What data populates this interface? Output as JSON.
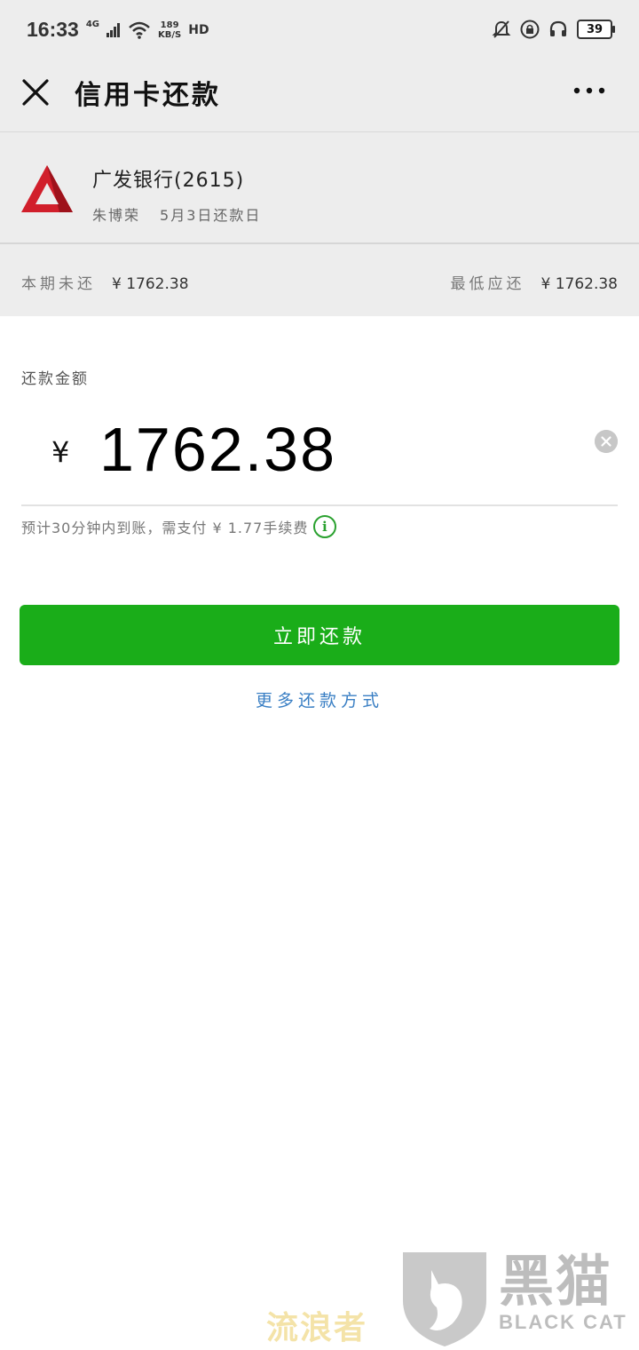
{
  "status_bar": {
    "time": "16:33",
    "network": "4G",
    "speed_value": "189",
    "speed_unit": "KB/S",
    "hd": "HD",
    "battery": "39"
  },
  "nav": {
    "title": "信用卡还款"
  },
  "card": {
    "bank_name": "广发银行(2615)",
    "holder": "朱博荣",
    "due": "5月3日还款日"
  },
  "summary": {
    "unpaid_label": "本期未还",
    "unpaid_value": "¥ 1762.38",
    "minimum_label": "最低应还",
    "minimum_value": "¥ 1762.38"
  },
  "repay": {
    "label": "还款金额",
    "currency": "¥",
    "amount": "1762.38",
    "fee_note": "预计30分钟内到账，需支付 ¥ 1.77手续费",
    "info_glyph": "i"
  },
  "actions": {
    "pay_button": "立即还款",
    "more_methods": "更多还款方式"
  },
  "watermark": {
    "text": "流浪者",
    "brand_cn": "黑猫",
    "brand_en": "BLACK CAT"
  },
  "colors": {
    "primary_green": "#1aad19",
    "link_blue": "#3a7fc4",
    "header_bg": "#ededed"
  },
  "icons": [
    "close-icon",
    "more-icon",
    "bank-logo",
    "clear-icon",
    "info-icon",
    "signal-icon",
    "wifi-icon",
    "mute-icon",
    "lock-icon",
    "headphone-icon"
  ]
}
